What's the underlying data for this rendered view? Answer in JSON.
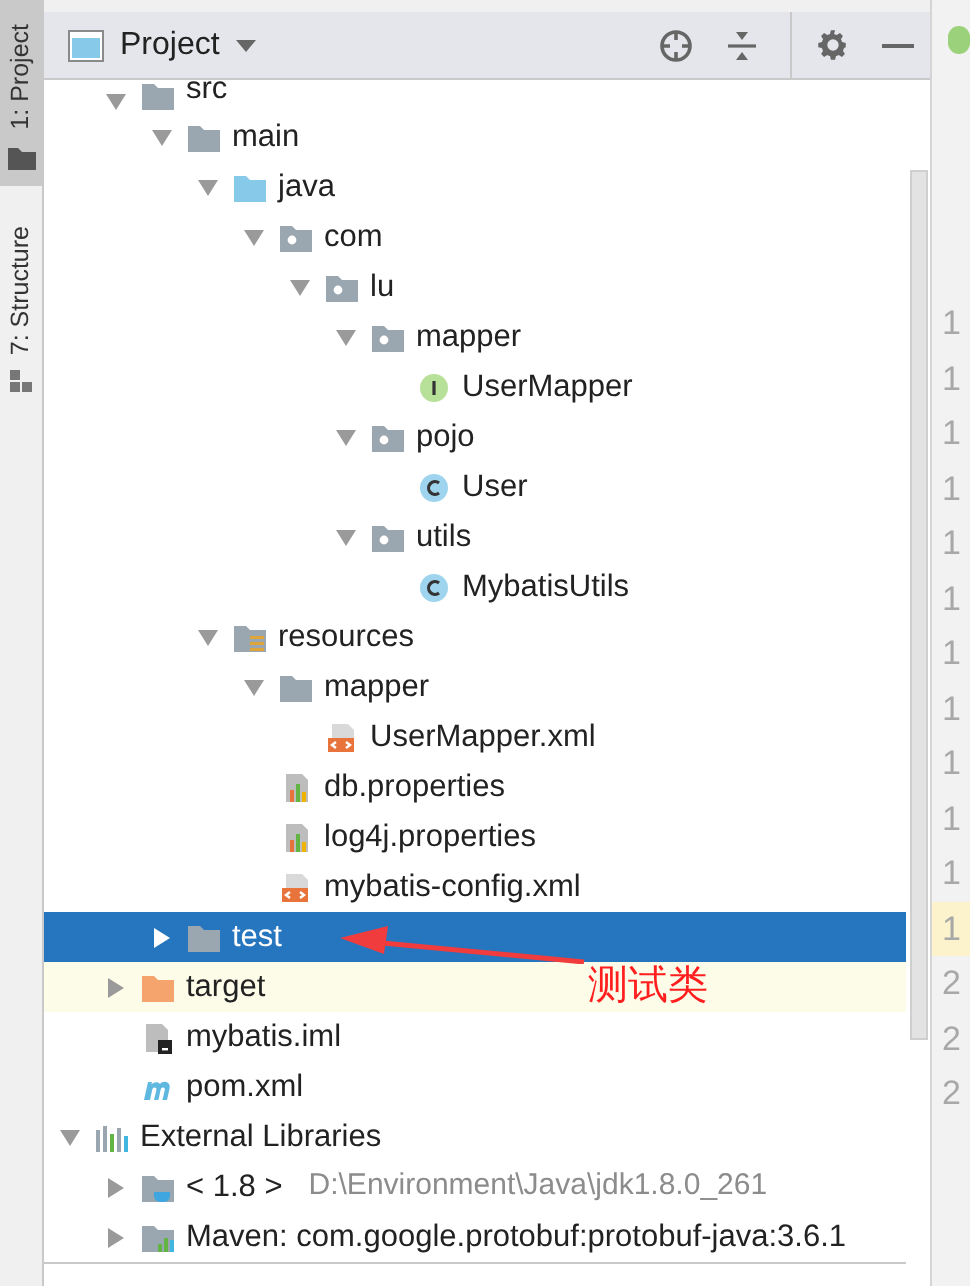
{
  "side_strip": [
    {
      "label": "1: Project",
      "selected": true
    },
    {
      "label": "7: Structure",
      "selected": false
    }
  ],
  "panel": {
    "title": "Project"
  },
  "tree": [
    {
      "label": "src",
      "kind": "folder",
      "expanded": true,
      "selected": false,
      "highlighted": false,
      "children": [
        {
          "label": "main",
          "kind": "folder",
          "expanded": true,
          "selected": false,
          "highlighted": false,
          "children": [
            {
              "label": "java",
              "kind": "source",
              "expanded": true,
              "selected": false,
              "highlighted": false,
              "children": [
                {
                  "label": "com",
                  "kind": "package",
                  "expanded": true,
                  "selected": false,
                  "highlighted": false,
                  "children": [
                    {
                      "label": "lu",
                      "kind": "package",
                      "expanded": true,
                      "selected": false,
                      "highlighted": false,
                      "children": [
                        {
                          "label": "mapper",
                          "kind": "package",
                          "expanded": true,
                          "selected": false,
                          "highlighted": false,
                          "children": [
                            {
                              "label": "UserMapper",
                              "kind": "interface",
                              "selected": false,
                              "highlighted": false
                            }
                          ]
                        },
                        {
                          "label": "pojo",
                          "kind": "package",
                          "expanded": true,
                          "selected": false,
                          "highlighted": false,
                          "children": [
                            {
                              "label": "User",
                              "kind": "class",
                              "selected": false,
                              "highlighted": false
                            }
                          ]
                        },
                        {
                          "label": "utils",
                          "kind": "package",
                          "expanded": true,
                          "selected": false,
                          "highlighted": false,
                          "children": [
                            {
                              "label": "MybatisUtils",
                              "kind": "class",
                              "selected": false,
                              "highlighted": false
                            }
                          ]
                        }
                      ]
                    }
                  ]
                }
              ]
            },
            {
              "label": "resources",
              "kind": "resources",
              "expanded": true,
              "selected": false,
              "highlighted": false,
              "children": [
                {
                  "label": "mapper",
                  "kind": "folder",
                  "expanded": true,
                  "selected": false,
                  "highlighted": false,
                  "children": [
                    {
                      "label": "UserMapper.xml",
                      "kind": "xml",
                      "selected": false,
                      "highlighted": false
                    }
                  ]
                },
                {
                  "label": "db.properties",
                  "kind": "properties",
                  "selected": false,
                  "highlighted": false
                },
                {
                  "label": "log4j.properties",
                  "kind": "properties",
                  "selected": false,
                  "highlighted": false
                },
                {
                  "label": "mybatis-config.xml",
                  "kind": "xml",
                  "selected": false,
                  "highlighted": false
                }
              ]
            }
          ]
        },
        {
          "label": "test",
          "kind": "folder",
          "expanded": false,
          "selected": true
        }
      ]
    },
    {
      "label": "target",
      "kind": "excluded",
      "expanded": false,
      "selected": false,
      "highlighted": true
    },
    {
      "label": "mybatis.iml",
      "kind": "iml",
      "selected": false,
      "highlighted": false
    },
    {
      "label": "pom.xml",
      "kind": "maven",
      "selected": false,
      "highlighted": false
    }
  ],
  "libraries": [
    {
      "label": "External Libraries",
      "kind": "libraries",
      "expanded": true,
      "selected": false,
      "highlighted": false,
      "children": [
        {
          "label": "< 1.8 >",
          "detail": "D:\\Environment\\Java\\jdk1.8.0_261",
          "kind": "jdk",
          "expanded": false,
          "selected": false,
          "highlighted": false
        },
        {
          "label": "Maven: com.google.protobuf:protobuf-java:3.6.1",
          "kind": "library",
          "expanded": false,
          "selected": false,
          "highlighted": false
        }
      ]
    }
  ],
  "gutter": [
    {
      "text": "1",
      "current": false
    },
    {
      "text": "1",
      "current": false
    },
    {
      "text": "1",
      "current": false
    },
    {
      "text": "1",
      "current": false
    },
    {
      "text": "1",
      "current": false
    },
    {
      "text": "1",
      "current": false
    },
    {
      "text": "1",
      "current": false
    },
    {
      "text": "1",
      "current": false
    },
    {
      "text": "1",
      "current": false
    },
    {
      "text": "1",
      "current": false
    },
    {
      "text": "1",
      "current": false
    },
    {
      "text": "1",
      "current": true
    },
    {
      "text": "2",
      "current": false
    },
    {
      "text": "2",
      "current": false
    },
    {
      "text": "2",
      "current": false
    }
  ],
  "annotation": {
    "text": "测试类"
  }
}
